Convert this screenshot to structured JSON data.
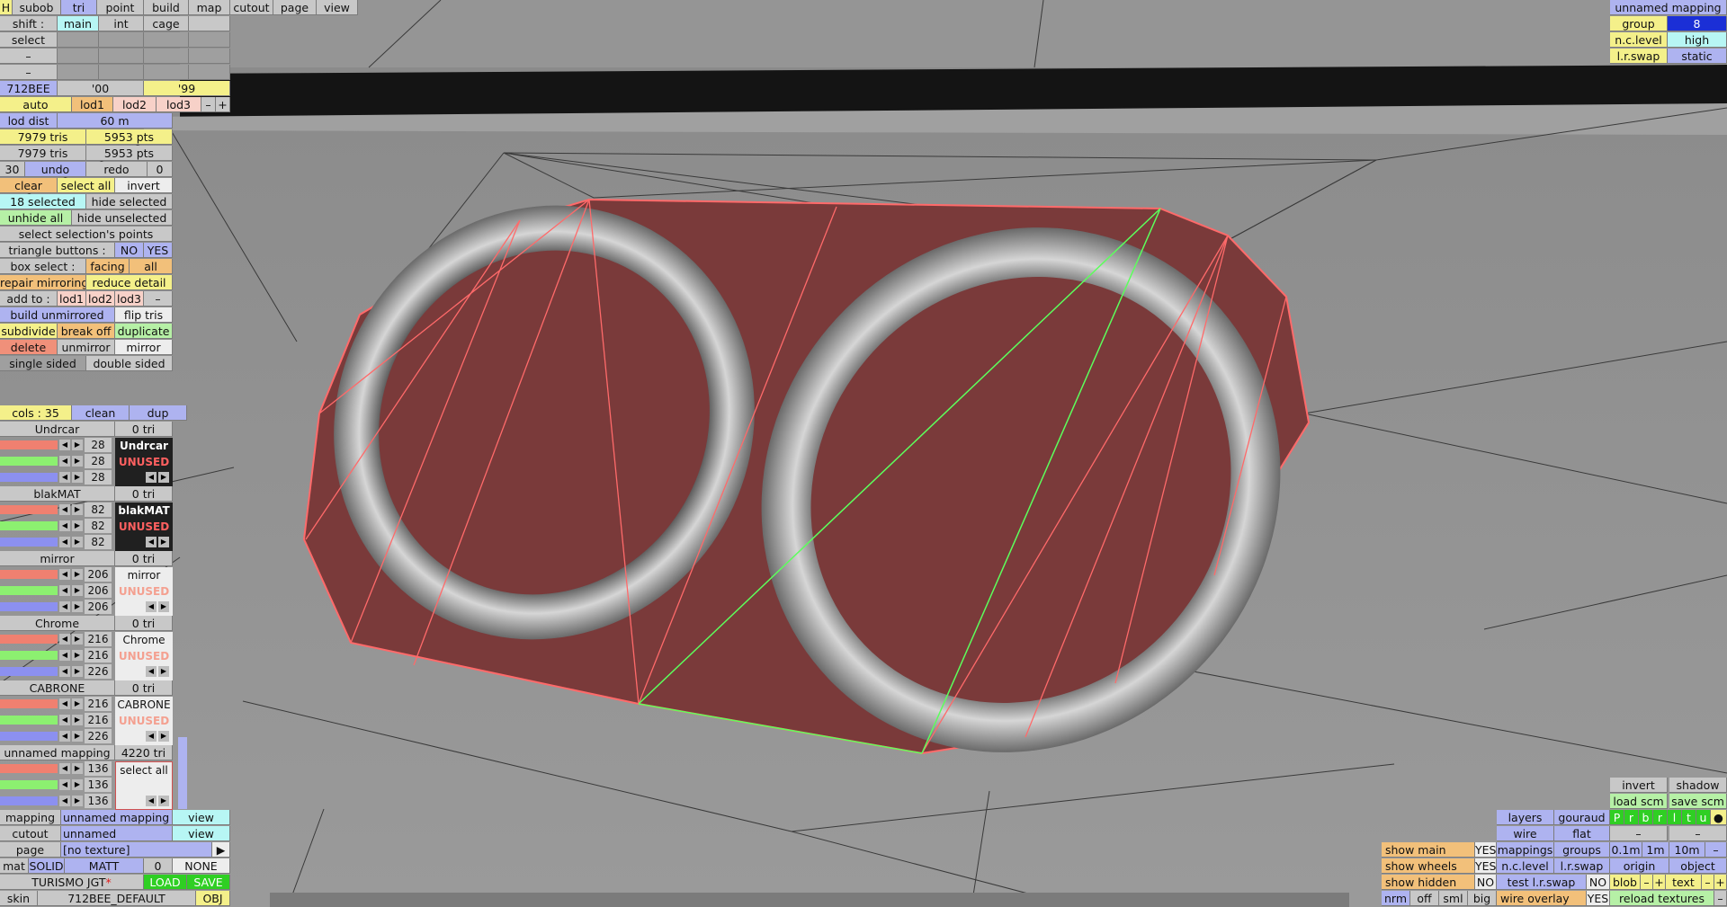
{
  "topbar": {
    "h": "H",
    "tabs": [
      "subob",
      "tri",
      "point",
      "build",
      "map",
      "cutout",
      "page",
      "view"
    ]
  },
  "shift": {
    "label": "shift :",
    "opts": [
      "main",
      "int",
      "cage"
    ]
  },
  "select_label": "select",
  "dash": "–",
  "car": {
    "code": "712BEE",
    "y1": "'00",
    "y2": "'99"
  },
  "lod": {
    "auto": "auto",
    "l1": "lod1",
    "l2": "lod2",
    "l3": "lod3",
    "minus": "–",
    "plus": "+"
  },
  "lod_dist": {
    "label": "lod dist",
    "value": "60 m"
  },
  "stats": [
    {
      "tris": "7979 tris",
      "pts": "5953 pts"
    },
    {
      "tris": "7979 tris",
      "pts": "5953 pts"
    }
  ],
  "undo": {
    "n1": "30",
    "undo": "undo",
    "redo": "redo",
    "n2": "0"
  },
  "ops": {
    "clear": "clear",
    "select_all": "select all",
    "invert": "invert",
    "selected": "18 selected",
    "hide_selected": "hide selected",
    "unhide_all": "unhide all",
    "hide_unselected": "hide unselected",
    "select_points": "select selection's points",
    "tri_buttons": "triangle buttons :",
    "no": "NO",
    "yes": "YES",
    "box_select": "box select :",
    "facing": "facing",
    "all": "all",
    "repair": "repair mirroring",
    "reduce": "reduce detail",
    "add_to": "add to :",
    "a1": "lod1",
    "a2": "lod2",
    "a3": "lod3",
    "build_unmirrored": "build unmirrored",
    "flip": "flip tris",
    "subdivide": "subdivide",
    "break_off": "break off",
    "duplicate": "duplicate",
    "delete": "delete",
    "unmirror": "unmirror",
    "mirror": "mirror",
    "single": "single sided",
    "double": "double sided"
  },
  "cols": {
    "label": "cols : 35",
    "clean": "clean",
    "dup": "dup"
  },
  "materials": [
    {
      "name": "Undrcar",
      "tri": "0 tri",
      "vals": [
        "28",
        "28",
        "28"
      ],
      "swatch": "Undrcar",
      "unused": "UNUSED",
      "dark": true
    },
    {
      "name": "blakMAT",
      "tri": "0 tri",
      "vals": [
        "82",
        "82",
        "82"
      ],
      "swatch": "blakMAT",
      "unused": "UNUSED",
      "dark": true
    },
    {
      "name": "mirror",
      "tri": "0 tri",
      "vals": [
        "206",
        "206",
        "206"
      ],
      "swatch": "mirror",
      "unused": "UNUSED",
      "dark": false
    },
    {
      "name": "Chrome",
      "tri": "0 tri",
      "vals": [
        "216",
        "216",
        "226"
      ],
      "swatch": "Chrome",
      "unused": "UNUSED",
      "dark": false
    },
    {
      "name": "CABRONE",
      "tri": "0 tri",
      "vals": [
        "216",
        "216",
        "226"
      ],
      "swatch": "CABRONE",
      "unused": "UNUSED",
      "dark": false
    },
    {
      "name": "unnamed mapping",
      "tri": "4220 tri",
      "vals": [
        "136",
        "136",
        "136"
      ],
      "swatch": "select all",
      "unused": "",
      "dark": false
    }
  ],
  "bottomleft": {
    "mapping": "mapping",
    "mapping_val": "unnamed mapping",
    "view": "view",
    "cutout": "cutout",
    "cutout_val": "unnamed",
    "page": "page",
    "page_val": "[no texture]",
    "mat": "mat",
    "solid": "SOLID",
    "matt": "MATT",
    "zero": "0",
    "none": "NONE",
    "turismo": "TURISMO JGT",
    "star": "*",
    "load": "LOAD",
    "save": "SAVE",
    "skin": "skin",
    "skin_val": "712BEE_DEFAULT",
    "obj": "OBJ"
  },
  "topright": {
    "title": "unnamed mapping",
    "group": "group",
    "group_val": "8",
    "nclevel": "n.c.level",
    "nclevel_val": "high",
    "lrswap": "l.r.swap",
    "lrswap_val": "static"
  },
  "br": {
    "invert": "invert",
    "shadow": "shadow",
    "load_scm": "load scm",
    "save_scm": "save scm",
    "layers": "layers",
    "gouraud": "gouraud",
    "letters": [
      "P",
      "r",
      "b",
      "r",
      "l",
      "t",
      "u"
    ],
    "dot": "●",
    "wire": "wire",
    "flat": "flat",
    "show_main": "show main",
    "yes": "YES",
    "mappings": "mappings",
    "groups": "groups",
    "d1": "0.1m",
    "d2": "1m",
    "d3": "10m",
    "show_wheels": "show wheels",
    "nclevel": "n.c.level",
    "lrswap": "l.r.swap",
    "origin": "origin",
    "object": "object",
    "show_hidden": "show hidden",
    "no": "NO",
    "test_lr": "test l.r.swap",
    "blob": "blob",
    "text": "text",
    "nrm": "nrm",
    "off": "off",
    "sml": "sml",
    "big": "big",
    "wire_overlay": "wire overlay",
    "reload": "reload textures"
  },
  "colors": {
    "selection_fill": "#7a3a3a",
    "selection_edge": "#ff6a6a",
    "highlight_edge": "#5cff5c"
  }
}
